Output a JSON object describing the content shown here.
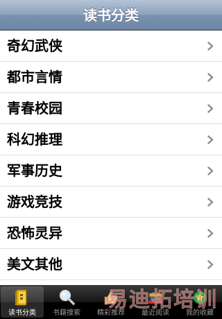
{
  "navbar": {
    "title": "读书分类"
  },
  "categories": [
    {
      "label": "奇幻武侠"
    },
    {
      "label": "都市言情"
    },
    {
      "label": "青春校园"
    },
    {
      "label": "科幻推理"
    },
    {
      "label": "军事历史"
    },
    {
      "label": "游戏竞技"
    },
    {
      "label": "恐怖灵异"
    },
    {
      "label": "美文其他"
    }
  ],
  "tabbar": {
    "tabs": [
      {
        "label": "读书分类",
        "icon": "book-category-icon",
        "selected": true
      },
      {
        "label": "书籍搜索",
        "icon": "magnifier-icon",
        "selected": false
      },
      {
        "label": "精彩推荐",
        "icon": "thumbs-up-icon",
        "selected": false
      },
      {
        "label": "最近阅读",
        "icon": "recent-books-icon",
        "selected": false
      },
      {
        "label": "我的收藏",
        "icon": "favorites-icon",
        "selected": false
      }
    ]
  },
  "watermark": {
    "text": "易迪拓培训"
  },
  "colors": {
    "navbar": "#7f95b2",
    "list_background": "#ffffff",
    "separator": "#e0e0e0",
    "chevron": "#8c8c8c",
    "tabbar": "#111111",
    "watermark": "#c0392b"
  }
}
